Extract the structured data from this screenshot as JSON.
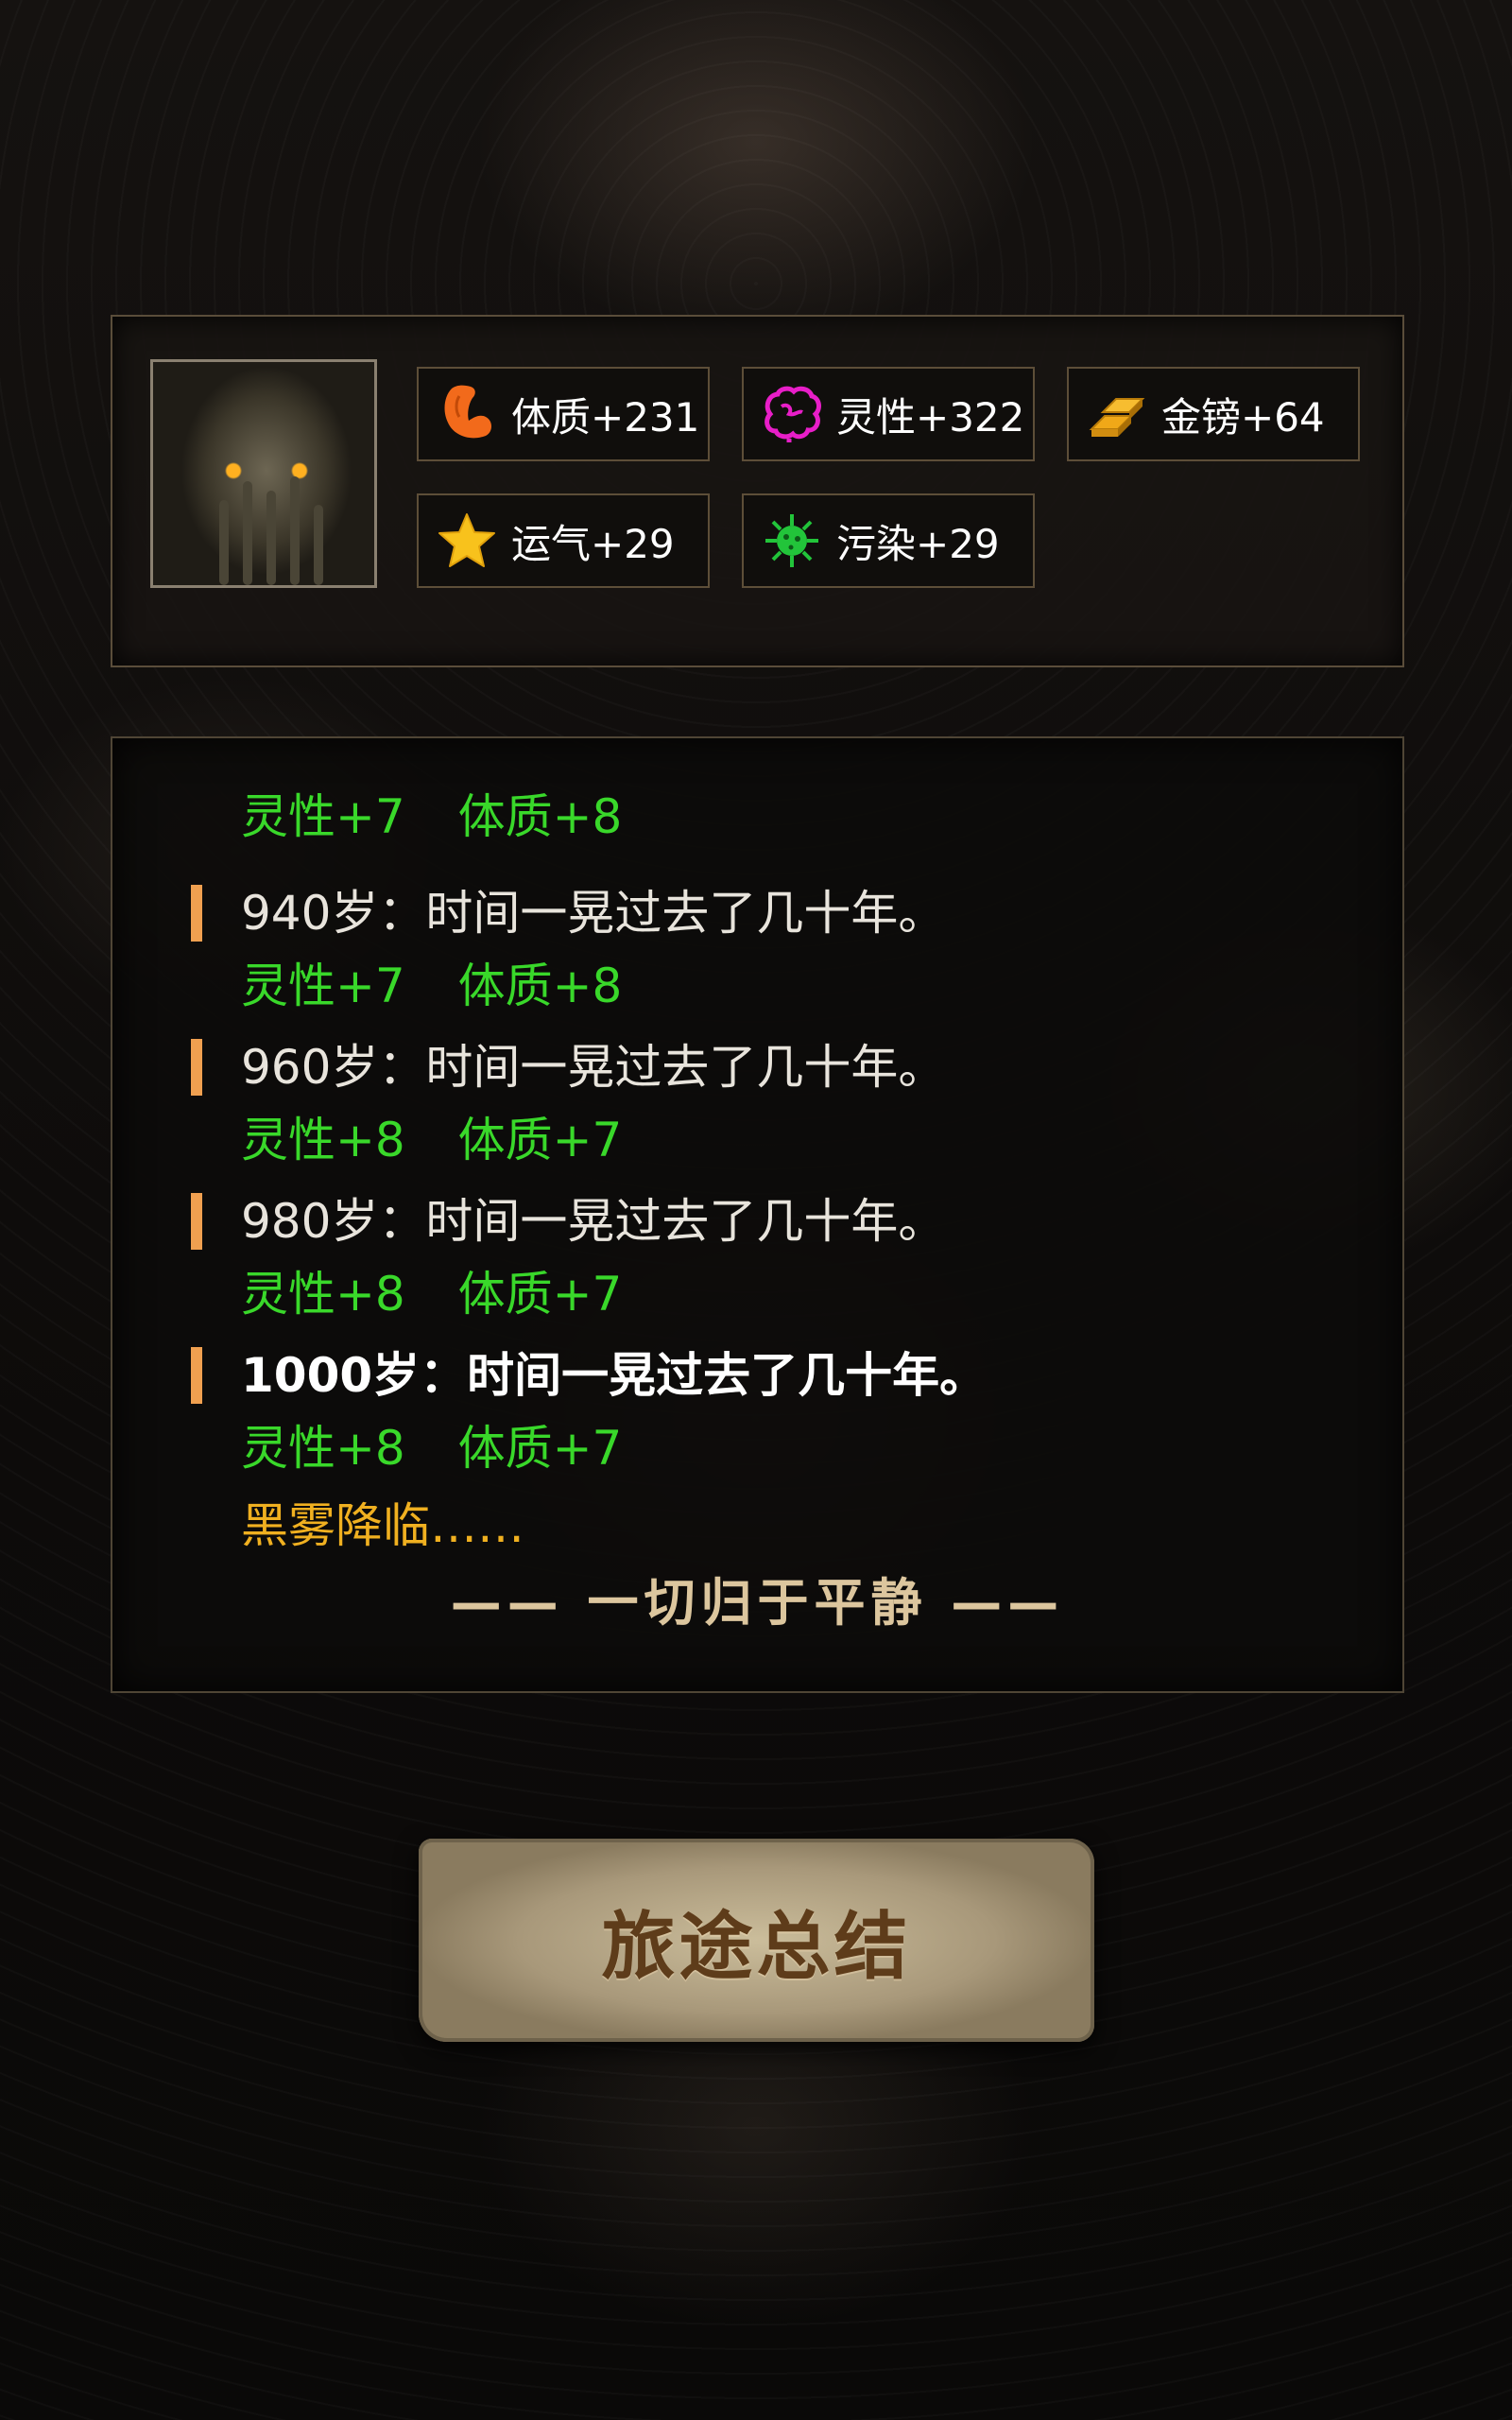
{
  "stats": {
    "items": [
      {
        "label": "体质+231",
        "icon": "muscle-arm-icon",
        "color": "#f26a1b"
      },
      {
        "label": "灵性+322",
        "icon": "brain-icon",
        "color": "#e81ec8"
      },
      {
        "label": "金镑+64",
        "icon": "gold-bars-icon",
        "color": "#f0a818"
      },
      {
        "label": "运气+29",
        "icon": "star-icon",
        "color": "#f8c21c"
      },
      {
        "label": "污染+29",
        "icon": "virus-icon",
        "color": "#22c43a"
      }
    ]
  },
  "log": {
    "lines": [
      {
        "text": "灵性+7 体质+8",
        "kind": "bonus"
      },
      {
        "text": "940岁：时间一晃过去了几十年。",
        "kind": "event"
      },
      {
        "text": "灵性+7 体质+8",
        "kind": "bonus"
      },
      {
        "text": "960岁：时间一晃过去了几十年。",
        "kind": "event"
      },
      {
        "text": "灵性+8 体质+7",
        "kind": "bonus"
      },
      {
        "text": "980岁：时间一晃过去了几十年。",
        "kind": "event"
      },
      {
        "text": "灵性+8 体质+7",
        "kind": "bonus"
      },
      {
        "text": "1000岁：时间一晃过去了几十年。",
        "kind": "event"
      },
      {
        "text": "灵性+8 体质+7",
        "kind": "bonus"
      },
      {
        "text": "黑雾降临……",
        "kind": "warn"
      }
    ],
    "ending": "—— 一切归于平静 ——"
  },
  "button": {
    "label": "旅途总结"
  },
  "colors": {
    "bonus": "#39d82a",
    "warn": "#f0b020",
    "marker": "#f0a050",
    "ending": "#dcc69e"
  }
}
